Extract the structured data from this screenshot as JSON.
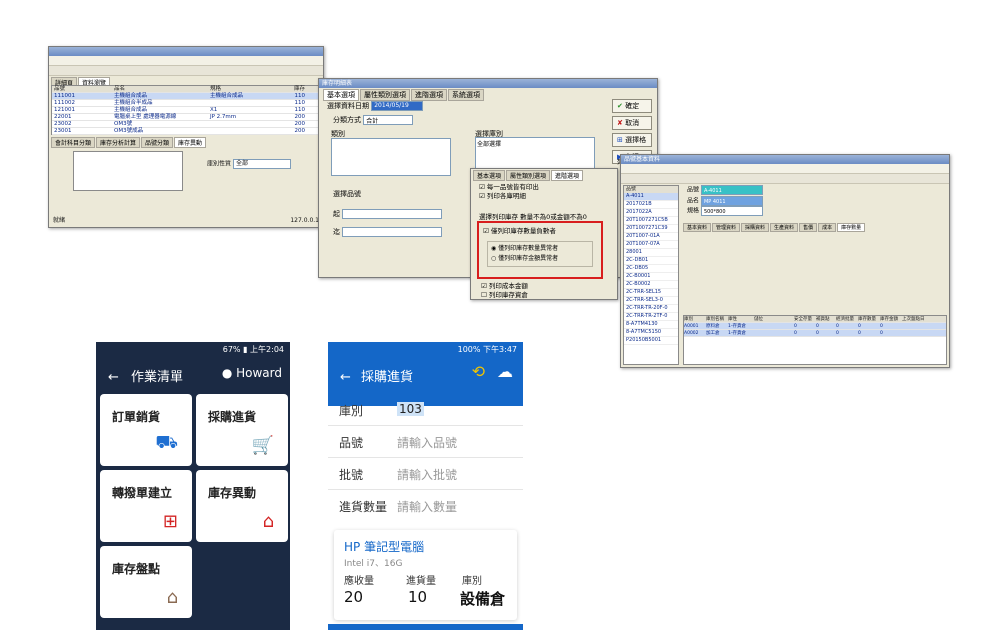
{
  "desktop1": {
    "tabs": [
      "詳細頁",
      "資料瀏覽"
    ],
    "columns": [
      "品號",
      "品名",
      "規格",
      "庫存"
    ],
    "rows": [
      [
        "111001",
        "主機組合成品",
        "主機組合成品",
        "110"
      ],
      [
        "111002",
        "主機組合半成品",
        "",
        "110"
      ],
      [
        "121001",
        "主機組合成品",
        "X1",
        "110"
      ],
      [
        "22001",
        "電腦桌上型 處理器電源線",
        "JP 2.7mm",
        "200"
      ],
      [
        "23002",
        "OM3號",
        "",
        "200"
      ],
      [
        "23001",
        "OM3號成品",
        "",
        "200"
      ],
      [
        "23002",
        "OM3號",
        "",
        "200"
      ]
    ],
    "subtabs": [
      "會計科目分類",
      "庫存分析計算",
      "品號分類",
      "庫存異動"
    ],
    "status_left": "就緒",
    "status_right": "127.0.0.1",
    "warehouse_label": "庫別性質",
    "warehouse_value": "全部"
  },
  "desktop2": {
    "title": "庫存明細表",
    "tabs": [
      "基本選項",
      "屬性類別選項",
      "進階選項",
      "系統選項"
    ],
    "date_label": "選擇資料日期",
    "date_value": "2014/05/19",
    "group_label": "分類方式",
    "group_value": "合計",
    "type_label": "類別",
    "pick_label": "選擇庫別",
    "all_pick": "全部選擇",
    "select_item_label": "選擇品號",
    "start_label": "起",
    "end_label": "迄",
    "buttons": [
      "確定",
      "取消",
      "選擇格",
      "自訂"
    ],
    "print_label": "列印"
  },
  "desktop2_popup": {
    "tabs": [
      "基本選項",
      "屬性類別選項",
      "進階選項",
      "系統選項"
    ],
    "options": [
      "每一品號皆有印出",
      "列印各庫明細"
    ],
    "print_stock_label": "選擇列印庫存",
    "print_stock_value": "數量不為0或金額不為0",
    "negative_label": "僅列印庫存數量負數者",
    "radio1": "僅列印庫存數量異常者",
    "radio2": "僅列印庫存金額異常者",
    "print_cost": "列印成本金額",
    "print_stock": "列印庫存資倉"
  },
  "desktop3": {
    "title": "品號基本資料",
    "fields": {
      "item_label": "品號",
      "name_label": "品名",
      "spec_label": "規格",
      "item_value": "A-4011",
      "name_value": "MP 4011",
      "spec_value": "500*800"
    },
    "list": [
      "A-4011",
      "2017021B",
      "2017022A",
      "20T1007271C5B",
      "20T1007271C39",
      "20T1007-01A",
      "20T1007-07A",
      "28001",
      "2C-DB01",
      "2C-DB05",
      "2C-B0001",
      "2C-B0002",
      "2C-TRR-SEL15",
      "2C-TRR-SEL3-0",
      "2C-TRR-TR-20F-0",
      "2C-TRR-TR-2TF-0",
      "8-A7TM4130",
      "8-A7TMC5150",
      "P20150B5001"
    ],
    "tabs": [
      "基本資料",
      "管理資料",
      "採購資料",
      "生產資料",
      "售價",
      "成本",
      "庫存數量",
      "屬性類別",
      "產品圖片",
      "說明資料"
    ],
    "bottom_columns": [
      "庫別",
      "庫別名稱",
      "庫性",
      "儲位",
      "安全存量",
      "補貨點",
      "經濟批量",
      "庫存數量",
      "庫存金額",
      "上次盤點日"
    ],
    "bottom_rows": [
      [
        "A0001",
        "原料倉",
        "1-存貨倉",
        "",
        "0",
        "0",
        "0",
        "0",
        "0",
        ""
      ],
      [
        "A0002",
        "加工倉",
        "1-存貨倉",
        "",
        "0",
        "0",
        "0",
        "0",
        "0",
        ""
      ]
    ]
  },
  "phone1": {
    "status_battery": "67%",
    "status_time": "上午2:04",
    "header_title": "作業清單",
    "user_name": "Howard",
    "cards": [
      {
        "label": "訂單銷貨",
        "icon": "truck-icon"
      },
      {
        "label": "採購進貨",
        "icon": "cart-icon"
      },
      {
        "label": "轉撥單建立",
        "icon": "clipboard-plus-icon"
      },
      {
        "label": "庫存異動",
        "icon": "warehouse-icon"
      },
      {
        "label": "庫存盤點",
        "icon": "inventory-house-icon"
      }
    ],
    "accent": "#1b2a44",
    "icon_color": "#1f6fd1",
    "alert_color": "#d32424"
  },
  "phone2": {
    "status_battery": "100%",
    "status_time": "下午3:47",
    "header_title": "採購進貨",
    "warehouse_label": "庫別",
    "warehouse_value": "103",
    "item_label": "品號",
    "item_placeholder": "請輸入品號",
    "lot_label": "批號",
    "lot_placeholder": "請輸入批號",
    "qty_label": "進貨數量",
    "qty_placeholder": "請輸入數量",
    "product_name": "HP 筆記型電腦",
    "product_spec": "Intel i7、16G",
    "col1_label": "應收量",
    "col2_label": "進貨量",
    "col3_label": "庫別",
    "col1_value": "20",
    "col2_value": "10",
    "col3_value": "設備倉",
    "accent": "#1467c8"
  }
}
